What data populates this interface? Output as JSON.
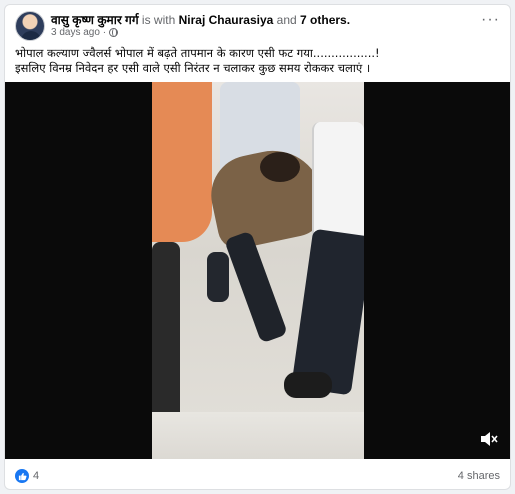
{
  "post": {
    "author": "वासु कृष्ण कुमार गर्ग",
    "with_prefix": "is with",
    "tagged": "Niraj Chaurasiya",
    "and_text": "and",
    "others": "7 others.",
    "time": "3 days ago ·",
    "caption_line1": "भोपाल कल्याण ज्वैलर्स भोपाल में बढ़ते तापमान के कारण एसी फट गया.................!",
    "caption_line2": "इसलिए विनम्र निवेदन हर एसी वाले एसी निरंतर न चलाकर कुछ समय रोककर चलाएं ।",
    "more_label": "···"
  },
  "video": {
    "muted": true,
    "icon": "speaker-muted-icon"
  },
  "footer": {
    "likes": "4",
    "shares": "4 shares"
  },
  "colors": {
    "accent": "#1877f2",
    "text_secondary": "#65676b"
  }
}
